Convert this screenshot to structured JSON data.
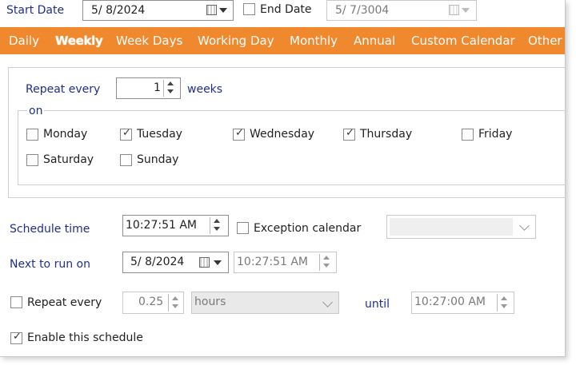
{
  "header": {
    "start_date_label": "Start Date",
    "start_date_value": "5/  8/2024",
    "end_date_label": "End Date",
    "end_date_value": "5/  7/3004",
    "end_date_checked": false
  },
  "tabs": [
    {
      "label": "Daily",
      "active": false
    },
    {
      "label": "Weekly",
      "active": true
    },
    {
      "label": "Week Days",
      "active": false
    },
    {
      "label": "Working Day",
      "active": false
    },
    {
      "label": "Monthly",
      "active": false
    },
    {
      "label": "Annual",
      "active": false
    },
    {
      "label": "Custom Calendar",
      "active": false
    },
    {
      "label": "Other",
      "active": false
    }
  ],
  "weekly": {
    "repeat_every_label": "Repeat every",
    "repeat_every_value": "1",
    "unit_label": "weeks",
    "on_label": "on",
    "days": [
      {
        "label": "Monday",
        "checked": false
      },
      {
        "label": "Tuesday",
        "checked": true
      },
      {
        "label": "Wednesday",
        "checked": true
      },
      {
        "label": "Thursday",
        "checked": true
      },
      {
        "label": "Friday",
        "checked": false
      },
      {
        "label": "Saturday",
        "checked": false
      },
      {
        "label": "Sunday",
        "checked": false
      }
    ]
  },
  "schedule": {
    "schedule_time_label": "Schedule time",
    "schedule_time_value": "10:27:51 AM",
    "exception_calendar_label": "Exception calendar",
    "exception_calendar_checked": false,
    "exception_calendar_value": "",
    "next_to_run_label": "Next to run on",
    "next_to_run_date": "5/  8/2024",
    "next_to_run_time": "10:27:51 AM",
    "repeat_every_label": "Repeat every",
    "repeat_every_checked": false,
    "repeat_every_value": "0.25",
    "repeat_unit": "hours",
    "until_label": "until",
    "until_value": "10:27:00 AM",
    "enable_label": "Enable this schedule",
    "enable_checked": true
  },
  "colors": {
    "tab_bar": "#f0882e",
    "label_blue": "#1f2f8f"
  },
  "check_glyph": "✓"
}
